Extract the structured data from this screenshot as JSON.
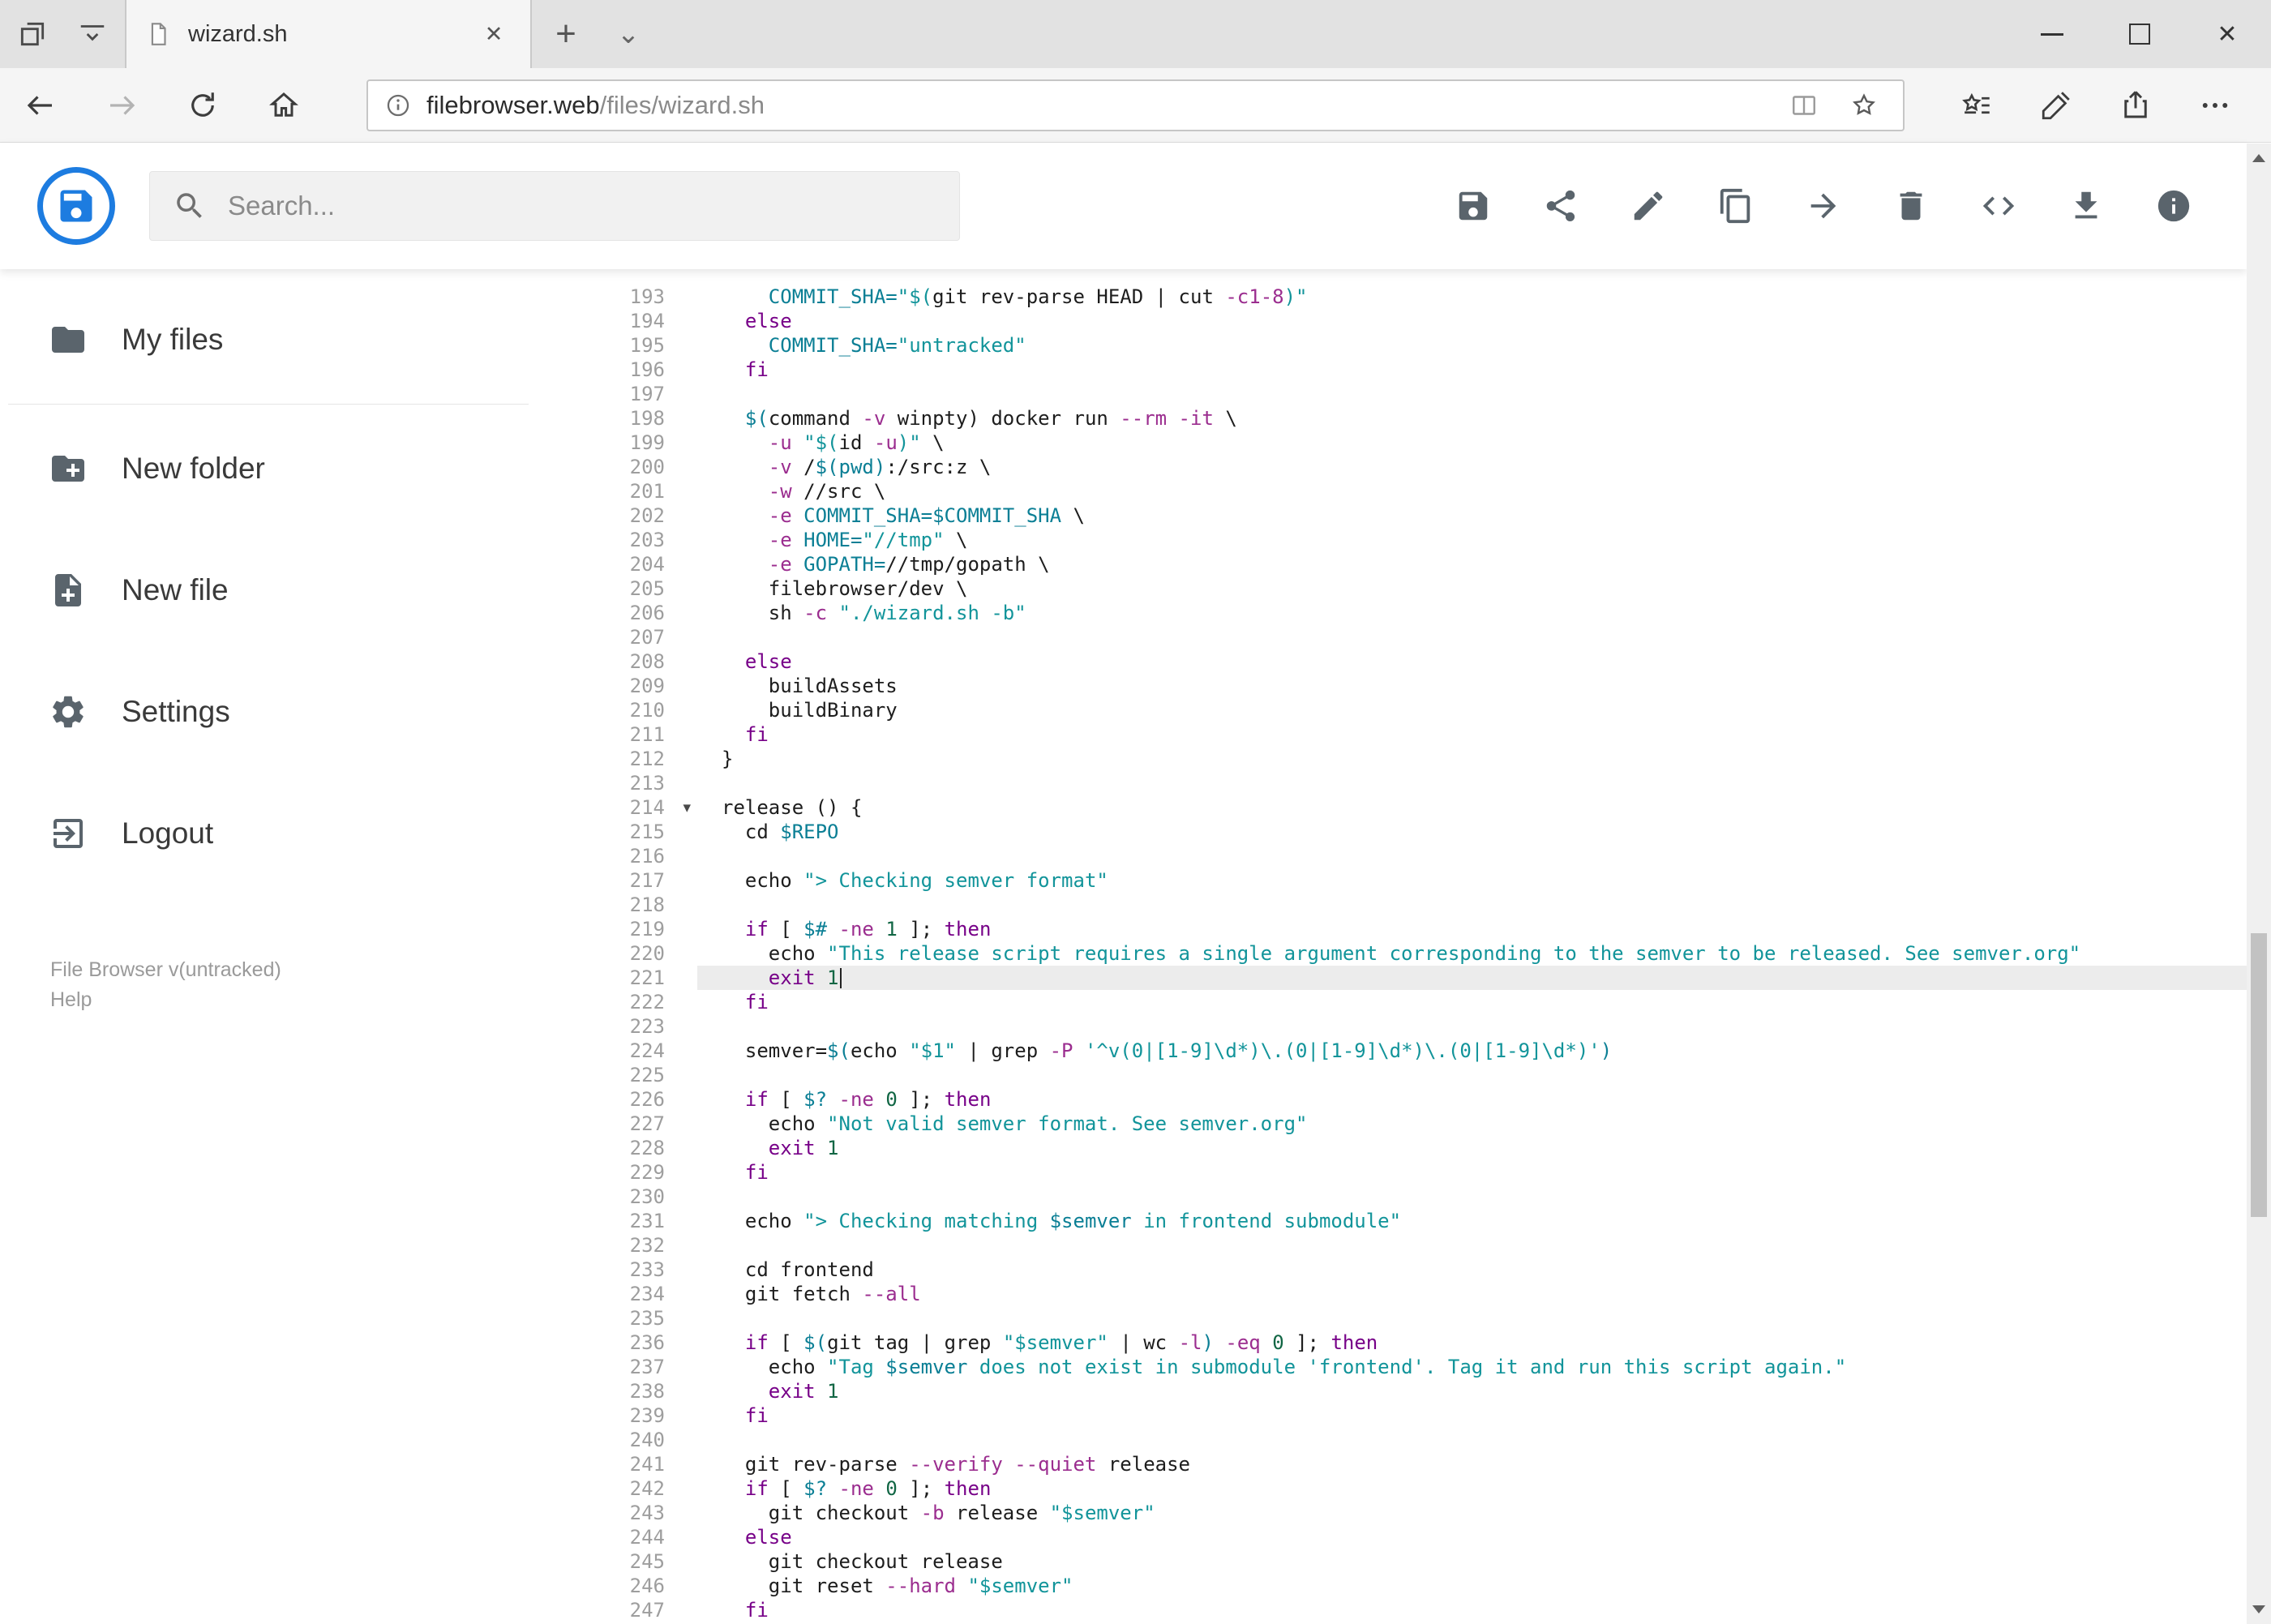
{
  "browser": {
    "tab_title": "wizard.sh",
    "tab_close_glyph": "✕",
    "new_tab_glyph": "+",
    "tab_overflow_glyph": "⌄",
    "window_close_glyph": "✕",
    "url_domain": "filebrowser.web",
    "url_path": "/files/wizard.sh"
  },
  "header": {
    "search_placeholder": "Search...",
    "accent_color": "#1d7ce0",
    "tool_icons": [
      "save",
      "share",
      "edit",
      "copy",
      "move",
      "delete",
      "code",
      "download",
      "info"
    ]
  },
  "sidebar": {
    "items": [
      {
        "label": "My files",
        "icon": "folder-icon"
      },
      {
        "label": "New folder",
        "icon": "new-folder-icon"
      },
      {
        "label": "New file",
        "icon": "new-file-icon"
      },
      {
        "label": "Settings",
        "icon": "gear-icon"
      },
      {
        "label": "Logout",
        "icon": "logout-icon"
      }
    ],
    "footer_version": "File Browser v(untracked)",
    "footer_help": "Help"
  },
  "editor": {
    "active_line": 221,
    "fold_marker_line": 214,
    "syntax_colors": {
      "keyword": "#770088",
      "string": "#12949a",
      "variable": "#0b7f95",
      "flag": "#9b2d8f",
      "number": "#116644"
    },
    "lines": [
      {
        "n": 193,
        "tokens": [
          [
            "t",
            "    "
          ],
          [
            "v",
            "COMMIT_SHA="
          ],
          [
            "s",
            "\"$("
          ],
          [
            "t",
            "git rev-parse HEAD | cut "
          ],
          [
            "f",
            "-c1-8"
          ],
          [
            "s",
            ")\""
          ]
        ]
      },
      {
        "n": 194,
        "tokens": [
          [
            "t",
            "  "
          ],
          [
            "k",
            "else"
          ]
        ]
      },
      {
        "n": 195,
        "tokens": [
          [
            "t",
            "    "
          ],
          [
            "v",
            "COMMIT_SHA="
          ],
          [
            "s",
            "\"untracked\""
          ]
        ]
      },
      {
        "n": 196,
        "tokens": [
          [
            "t",
            "  "
          ],
          [
            "k",
            "fi"
          ]
        ]
      },
      {
        "n": 197,
        "tokens": []
      },
      {
        "n": 198,
        "tokens": [
          [
            "t",
            "  "
          ],
          [
            "v",
            "$("
          ],
          [
            "t",
            "command "
          ],
          [
            "f",
            "-v"
          ],
          [
            "t",
            " winpty) docker run "
          ],
          [
            "f",
            "--rm"
          ],
          [
            "t",
            " "
          ],
          [
            "f",
            "-it"
          ],
          [
            "t",
            " \\"
          ]
        ]
      },
      {
        "n": 199,
        "tokens": [
          [
            "t",
            "    "
          ],
          [
            "f",
            "-u"
          ],
          [
            "t",
            " "
          ],
          [
            "s",
            "\"$("
          ],
          [
            "t",
            "id "
          ],
          [
            "f",
            "-u"
          ],
          [
            "s",
            ")\""
          ],
          [
            "t",
            " \\"
          ]
        ]
      },
      {
        "n": 200,
        "tokens": [
          [
            "t",
            "    "
          ],
          [
            "f",
            "-v"
          ],
          [
            "t",
            " /"
          ],
          [
            "v",
            "$(pwd)"
          ],
          [
            "t",
            ":/src:z \\"
          ]
        ]
      },
      {
        "n": 201,
        "tokens": [
          [
            "t",
            "    "
          ],
          [
            "f",
            "-w"
          ],
          [
            "t",
            " //src \\"
          ]
        ]
      },
      {
        "n": 202,
        "tokens": [
          [
            "t",
            "    "
          ],
          [
            "f",
            "-e"
          ],
          [
            "t",
            " "
          ],
          [
            "v",
            "COMMIT_SHA=$COMMIT_SHA"
          ],
          [
            "t",
            " \\"
          ]
        ]
      },
      {
        "n": 203,
        "tokens": [
          [
            "t",
            "    "
          ],
          [
            "f",
            "-e"
          ],
          [
            "t",
            " "
          ],
          [
            "v",
            "HOME="
          ],
          [
            "s",
            "\"//tmp\""
          ],
          [
            "t",
            " \\"
          ]
        ]
      },
      {
        "n": 204,
        "tokens": [
          [
            "t",
            "    "
          ],
          [
            "f",
            "-e"
          ],
          [
            "t",
            " "
          ],
          [
            "v",
            "GOPATH="
          ],
          [
            "t",
            "//tmp/gopath \\"
          ]
        ]
      },
      {
        "n": 205,
        "tokens": [
          [
            "t",
            "    filebrowser/dev \\"
          ]
        ]
      },
      {
        "n": 206,
        "tokens": [
          [
            "t",
            "    sh "
          ],
          [
            "f",
            "-c"
          ],
          [
            "t",
            " "
          ],
          [
            "s",
            "\"./wizard.sh -b\""
          ]
        ]
      },
      {
        "n": 207,
        "tokens": []
      },
      {
        "n": 208,
        "tokens": [
          [
            "t",
            "  "
          ],
          [
            "k",
            "else"
          ]
        ]
      },
      {
        "n": 209,
        "tokens": [
          [
            "t",
            "    buildAssets"
          ]
        ]
      },
      {
        "n": 210,
        "tokens": [
          [
            "t",
            "    buildBinary"
          ]
        ]
      },
      {
        "n": 211,
        "tokens": [
          [
            "t",
            "  "
          ],
          [
            "k",
            "fi"
          ]
        ]
      },
      {
        "n": 212,
        "tokens": [
          [
            "t",
            "}"
          ]
        ]
      },
      {
        "n": 213,
        "tokens": []
      },
      {
        "n": 214,
        "tokens": [
          [
            "t",
            "release () {"
          ]
        ]
      },
      {
        "n": 215,
        "tokens": [
          [
            "t",
            "  cd "
          ],
          [
            "v",
            "$REPO"
          ]
        ]
      },
      {
        "n": 216,
        "tokens": []
      },
      {
        "n": 217,
        "tokens": [
          [
            "t",
            "  echo "
          ],
          [
            "s",
            "\"> Checking semver format\""
          ]
        ]
      },
      {
        "n": 218,
        "tokens": []
      },
      {
        "n": 219,
        "tokens": [
          [
            "t",
            "  "
          ],
          [
            "k",
            "if"
          ],
          [
            "t",
            " [ "
          ],
          [
            "v",
            "$#"
          ],
          [
            "t",
            " "
          ],
          [
            "f",
            "-ne"
          ],
          [
            "t",
            " "
          ],
          [
            "n",
            "1"
          ],
          [
            "t",
            " ]; "
          ],
          [
            "k",
            "then"
          ]
        ]
      },
      {
        "n": 220,
        "tokens": [
          [
            "t",
            "    echo "
          ],
          [
            "s",
            "\"This release script requires a single argument corresponding to the semver to be released. See semver.org\""
          ]
        ]
      },
      {
        "n": 221,
        "tokens": [
          [
            "t",
            "    "
          ],
          [
            "k",
            "exit"
          ],
          [
            "t",
            " "
          ],
          [
            "n",
            "1"
          ]
        ]
      },
      {
        "n": 222,
        "tokens": [
          [
            "t",
            "  "
          ],
          [
            "k",
            "fi"
          ]
        ]
      },
      {
        "n": 223,
        "tokens": []
      },
      {
        "n": 224,
        "tokens": [
          [
            "t",
            "  semver="
          ],
          [
            "v",
            "$("
          ],
          [
            "t",
            "echo "
          ],
          [
            "s",
            "\"$1\""
          ],
          [
            "t",
            " | grep "
          ],
          [
            "f",
            "-P"
          ],
          [
            "t",
            " "
          ],
          [
            "s",
            "'^v(0|[1-9]\\d*)\\.(0|[1-9]\\d*)\\.(0|[1-9]\\d*)'"
          ],
          [
            "v",
            ")"
          ]
        ]
      },
      {
        "n": 225,
        "tokens": []
      },
      {
        "n": 226,
        "tokens": [
          [
            "t",
            "  "
          ],
          [
            "k",
            "if"
          ],
          [
            "t",
            " [ "
          ],
          [
            "v",
            "$?"
          ],
          [
            "t",
            " "
          ],
          [
            "f",
            "-ne"
          ],
          [
            "t",
            " "
          ],
          [
            "n",
            "0"
          ],
          [
            "t",
            " ]; "
          ],
          [
            "k",
            "then"
          ]
        ]
      },
      {
        "n": 227,
        "tokens": [
          [
            "t",
            "    echo "
          ],
          [
            "s",
            "\"Not valid semver format. See semver.org\""
          ]
        ]
      },
      {
        "n": 228,
        "tokens": [
          [
            "t",
            "    "
          ],
          [
            "k",
            "exit"
          ],
          [
            "t",
            " "
          ],
          [
            "n",
            "1"
          ]
        ]
      },
      {
        "n": 229,
        "tokens": [
          [
            "t",
            "  "
          ],
          [
            "k",
            "fi"
          ]
        ]
      },
      {
        "n": 230,
        "tokens": []
      },
      {
        "n": 231,
        "tokens": [
          [
            "t",
            "  echo "
          ],
          [
            "s",
            "\"> Checking matching "
          ],
          [
            "v",
            "$semver"
          ],
          [
            "s",
            " in frontend submodule\""
          ]
        ]
      },
      {
        "n": 232,
        "tokens": []
      },
      {
        "n": 233,
        "tokens": [
          [
            "t",
            "  cd frontend"
          ]
        ]
      },
      {
        "n": 234,
        "tokens": [
          [
            "t",
            "  git fetch "
          ],
          [
            "f",
            "--all"
          ]
        ]
      },
      {
        "n": 235,
        "tokens": []
      },
      {
        "n": 236,
        "tokens": [
          [
            "t",
            "  "
          ],
          [
            "k",
            "if"
          ],
          [
            "t",
            " [ "
          ],
          [
            "v",
            "$("
          ],
          [
            "t",
            "git tag | grep "
          ],
          [
            "s",
            "\"$semver\""
          ],
          [
            "t",
            " | wc "
          ],
          [
            "f",
            "-l"
          ],
          [
            "v",
            ")"
          ],
          [
            "t",
            " "
          ],
          [
            "f",
            "-eq"
          ],
          [
            "t",
            " "
          ],
          [
            "n",
            "0"
          ],
          [
            "t",
            " ]; "
          ],
          [
            "k",
            "then"
          ]
        ]
      },
      {
        "n": 237,
        "tokens": [
          [
            "t",
            "    echo "
          ],
          [
            "s",
            "\"Tag "
          ],
          [
            "v",
            "$semver"
          ],
          [
            "s",
            " does not exist in submodule 'frontend'. Tag it and run this script again.\""
          ]
        ]
      },
      {
        "n": 238,
        "tokens": [
          [
            "t",
            "    "
          ],
          [
            "k",
            "exit"
          ],
          [
            "t",
            " "
          ],
          [
            "n",
            "1"
          ]
        ]
      },
      {
        "n": 239,
        "tokens": [
          [
            "t",
            "  "
          ],
          [
            "k",
            "fi"
          ]
        ]
      },
      {
        "n": 240,
        "tokens": []
      },
      {
        "n": 241,
        "tokens": [
          [
            "t",
            "  git rev-parse "
          ],
          [
            "f",
            "--verify"
          ],
          [
            "t",
            " "
          ],
          [
            "f",
            "--quiet"
          ],
          [
            "t",
            " release"
          ]
        ]
      },
      {
        "n": 242,
        "tokens": [
          [
            "t",
            "  "
          ],
          [
            "k",
            "if"
          ],
          [
            "t",
            " [ "
          ],
          [
            "v",
            "$?"
          ],
          [
            "t",
            " "
          ],
          [
            "f",
            "-ne"
          ],
          [
            "t",
            " "
          ],
          [
            "n",
            "0"
          ],
          [
            "t",
            " ]; "
          ],
          [
            "k",
            "then"
          ]
        ]
      },
      {
        "n": 243,
        "tokens": [
          [
            "t",
            "    git checkout "
          ],
          [
            "f",
            "-b"
          ],
          [
            "t",
            " release "
          ],
          [
            "s",
            "\"$semver\""
          ]
        ]
      },
      {
        "n": 244,
        "tokens": [
          [
            "t",
            "  "
          ],
          [
            "k",
            "else"
          ]
        ]
      },
      {
        "n": 245,
        "tokens": [
          [
            "t",
            "    git checkout release"
          ]
        ]
      },
      {
        "n": 246,
        "tokens": [
          [
            "t",
            "    git reset "
          ],
          [
            "f",
            "--hard"
          ],
          [
            "t",
            " "
          ],
          [
            "s",
            "\"$semver\""
          ]
        ]
      },
      {
        "n": 247,
        "tokens": [
          [
            "t",
            "  "
          ],
          [
            "k",
            "fi"
          ]
        ]
      }
    ]
  }
}
